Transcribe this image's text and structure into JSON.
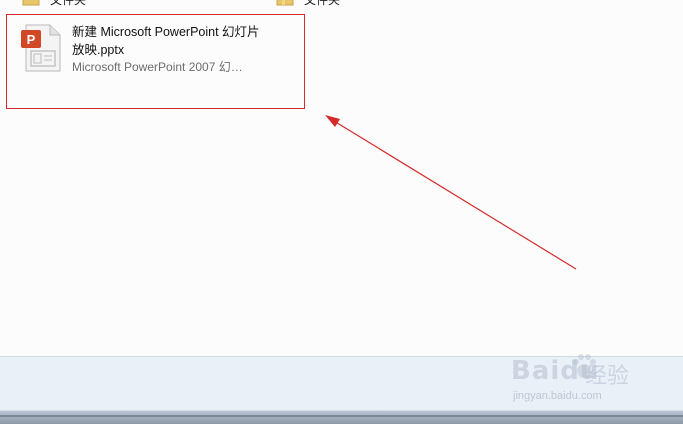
{
  "folders": [
    {
      "label": "文件夹"
    },
    {
      "label": "文件夹"
    }
  ],
  "file": {
    "name": "新建 Microsoft PowerPoint 幻灯片放映.pptx",
    "type": "Microsoft PowerPoint 2007 幻…",
    "icon": "powerpoint-file-icon",
    "icon_letter": "P"
  },
  "annotation": {
    "color": "#d42a2a"
  },
  "watermark": {
    "brand": "Bai",
    "brand2": "du",
    "product": "经验",
    "url": "jingyan.baidu.com"
  }
}
